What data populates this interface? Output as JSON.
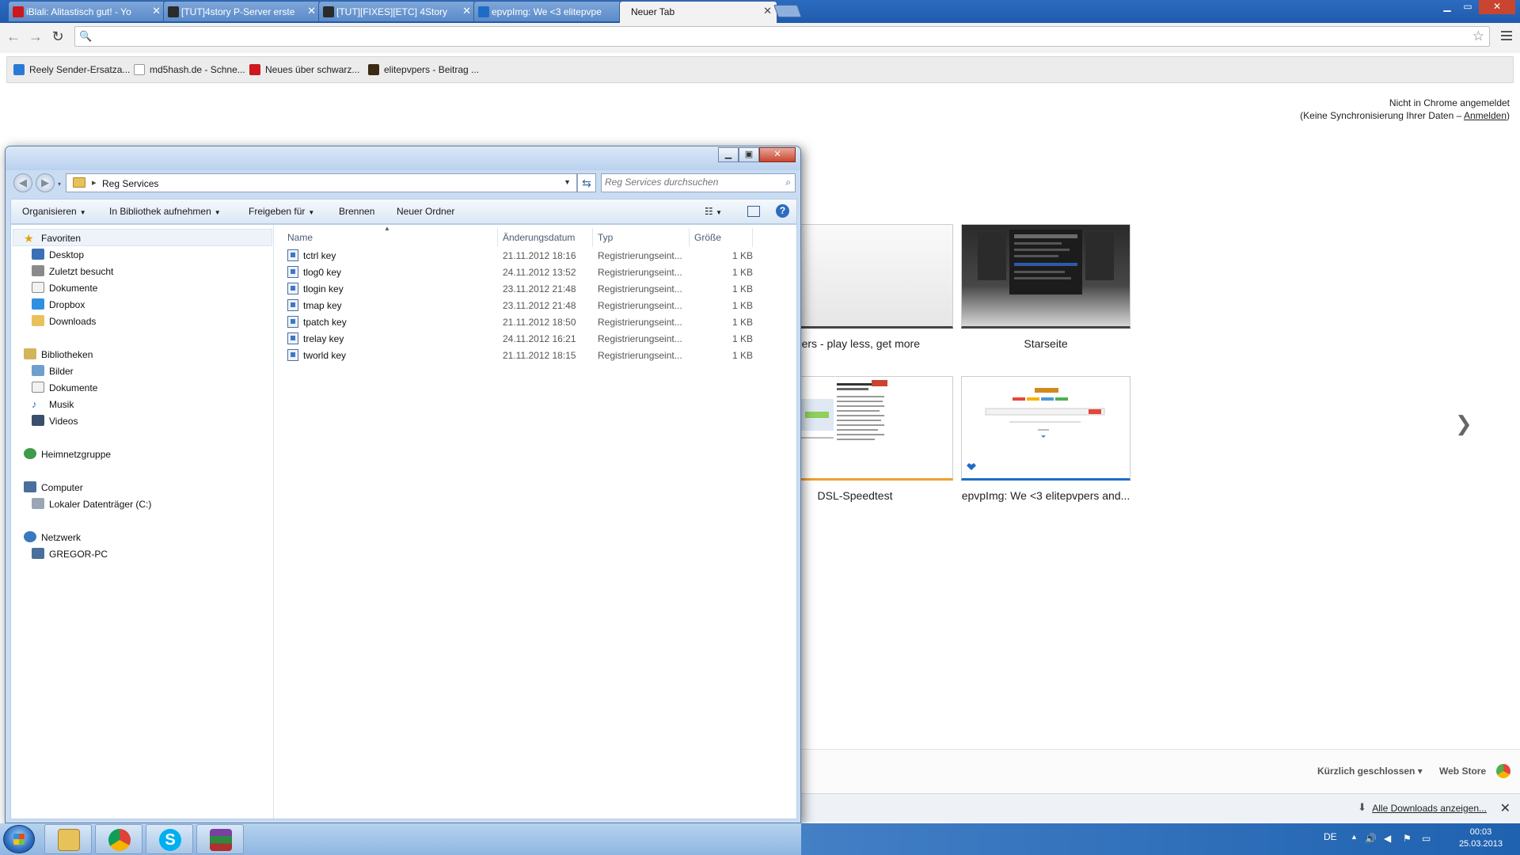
{
  "browser": {
    "tabs": [
      {
        "title": "iBlali: Alitastisch gut! - Yo",
        "favicon_color": "#cc181e"
      },
      {
        "title": "[TUT]4story P-Server erste",
        "favicon_color": "#2b2b2b"
      },
      {
        "title": "[TUT][FIXES][ETC] 4Story",
        "favicon_color": "#2b2b2b"
      },
      {
        "title": "epvpImg: We <3 elitepvpe",
        "favicon_color": "#1f6cc6"
      },
      {
        "title": "Neuer Tab",
        "favicon_color": ""
      }
    ],
    "window_controls": {
      "minimize": "▁",
      "maximize": "▭",
      "close": "✕"
    },
    "omnibox": {
      "value": "",
      "placeholder": ""
    },
    "bookmarks": [
      {
        "label": "Reely Sender-Ersatza...",
        "favicon_color": "#2a7ad5"
      },
      {
        "label": "md5hash.de - Schne...",
        "favicon_color": "#ffffff"
      },
      {
        "label": "Neues über schwarz...",
        "favicon_color": "#cc181e"
      },
      {
        "label": "elitepvpers - Beitrag ...",
        "favicon_color": "#3b2a14"
      }
    ],
    "signin": {
      "line1": "Nicht in Chrome angemeldet",
      "line2_prefix": "(Keine Synchronisierung Ihrer Daten – ",
      "link": "Anmelden",
      "line2_suffix": ")"
    },
    "thumbnails": [
      {
        "label": "pvpers - play less, get more"
      },
      {
        "label": "Starseite"
      },
      {
        "label": "DSL-Speedtest"
      },
      {
        "label": "epvpImg: We <3 elitepvpers and..."
      }
    ],
    "next_arrow": "❯",
    "footer": {
      "recently_closed": "Kürzlich geschlossen",
      "web_store": "Web Store"
    },
    "download_bar": {
      "show_all": "Alle Downloads anzeigen...",
      "close": "✕"
    }
  },
  "explorer": {
    "caption": {
      "minimize": "▁",
      "maximize": "▣",
      "close": "✕"
    },
    "address": {
      "path": "Reg Services"
    },
    "search": {
      "placeholder": "Reg Services durchsuchen"
    },
    "commands": {
      "organize": "Organisieren",
      "library": "In Bibliothek aufnehmen",
      "share": "Freigeben für",
      "burn": "Brennen",
      "new_folder": "Neuer Ordner"
    },
    "navpane": {
      "favorites": "Favoriten",
      "favorites_items": [
        "Desktop",
        "Zuletzt besucht",
        "Dokumente",
        "Dropbox",
        "Downloads"
      ],
      "libraries": "Bibliotheken",
      "libraries_items": [
        "Bilder",
        "Dokumente",
        "Musik",
        "Videos"
      ],
      "homegroup": "Heimnetzgruppe",
      "computer": "Computer",
      "computer_items": [
        "Lokaler Datenträger (C:)"
      ],
      "network": "Netzwerk",
      "network_items": [
        "GREGOR-PC"
      ]
    },
    "columns": {
      "name": "Name",
      "date": "Änderungsdatum",
      "type": "Typ",
      "size": "Größe"
    },
    "files": [
      {
        "name": "tctrl key",
        "date": "21.11.2012 18:16",
        "type": "Registrierungseint...",
        "size": "1 KB"
      },
      {
        "name": "tlog0 key",
        "date": "24.11.2012 13:52",
        "type": "Registrierungseint...",
        "size": "1 KB"
      },
      {
        "name": "tlogin key",
        "date": "23.11.2012 21:48",
        "type": "Registrierungseint...",
        "size": "1 KB"
      },
      {
        "name": "tmap key",
        "date": "23.11.2012 21:48",
        "type": "Registrierungseint...",
        "size": "1 KB"
      },
      {
        "name": "tpatch key",
        "date": "21.11.2012 18:50",
        "type": "Registrierungseint...",
        "size": "1 KB"
      },
      {
        "name": "trelay key",
        "date": "24.11.2012 16:21",
        "type": "Registrierungseint...",
        "size": "1 KB"
      },
      {
        "name": "tworld key",
        "date": "21.11.2012 18:15",
        "type": "Registrierungseint...",
        "size": "1 KB"
      }
    ]
  },
  "taskbar": {
    "language": "DE",
    "clock_time": "00:03",
    "clock_date": "25.03.2013"
  }
}
